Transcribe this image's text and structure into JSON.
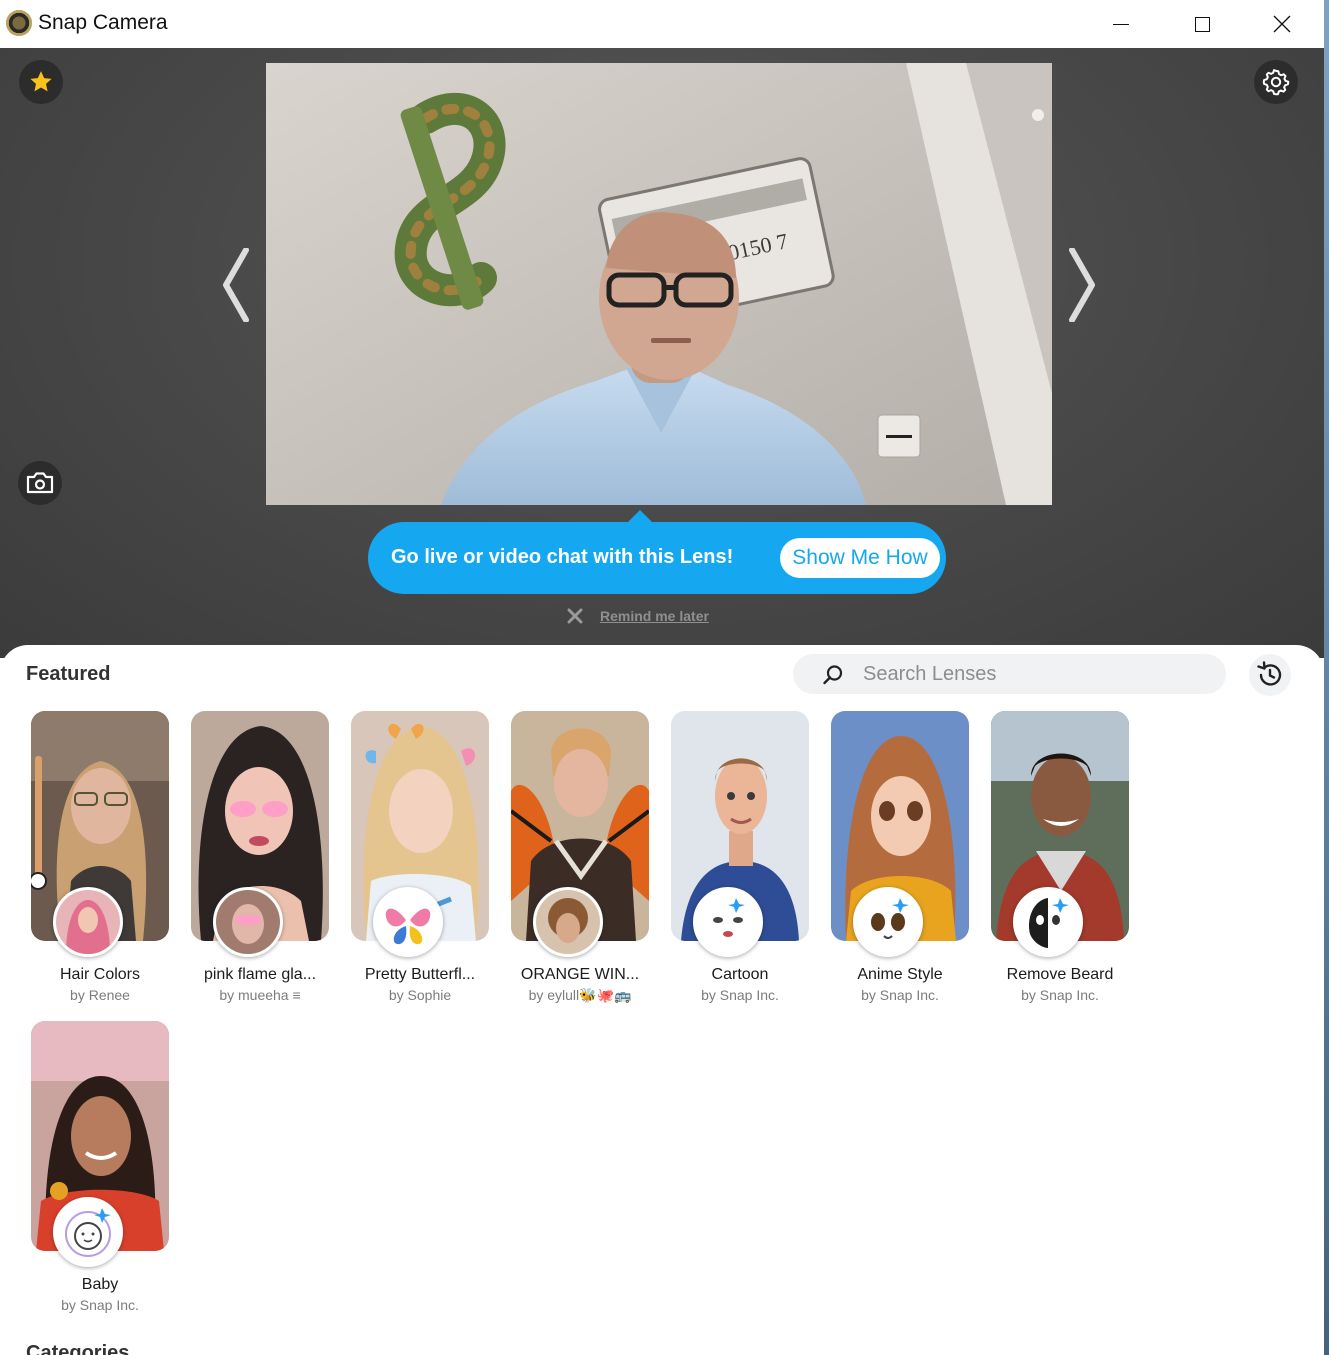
{
  "window": {
    "title": "Snap Camera",
    "controls": {
      "minimize": "minimize",
      "maximize": "maximize",
      "close": "close"
    }
  },
  "preview": {
    "favorite_icon": "star-icon",
    "settings_icon": "gear-icon",
    "snapshot_icon": "camera-icon",
    "prev_icon": "chevron-left-icon",
    "next_icon": "chevron-right-icon"
  },
  "promo": {
    "message": "Go live or video chat with this Lens!",
    "cta": "Show Me How",
    "dismiss": "Remind me later",
    "color": "#15a7f0"
  },
  "featured": {
    "title": "Featured",
    "search_placeholder": "Search Lenses",
    "search_value": "",
    "lenses": [
      {
        "name": "Hair Colors",
        "author": "by Renee"
      },
      {
        "name": "pink flame gla...",
        "author": "by mueeha ≡"
      },
      {
        "name": "Pretty Butterfl...",
        "author": "by Sophie"
      },
      {
        "name": "ORANGE WIN...",
        "author": "by eylull🐝🐙🚌"
      },
      {
        "name": "Cartoon",
        "author": "by Snap Inc."
      },
      {
        "name": "Anime Style",
        "author": "by Snap Inc."
      },
      {
        "name": "Remove Beard",
        "author": "by Snap Inc."
      },
      {
        "name": "Baby",
        "author": "by Snap Inc."
      }
    ]
  },
  "categories": {
    "title": "Categories"
  }
}
